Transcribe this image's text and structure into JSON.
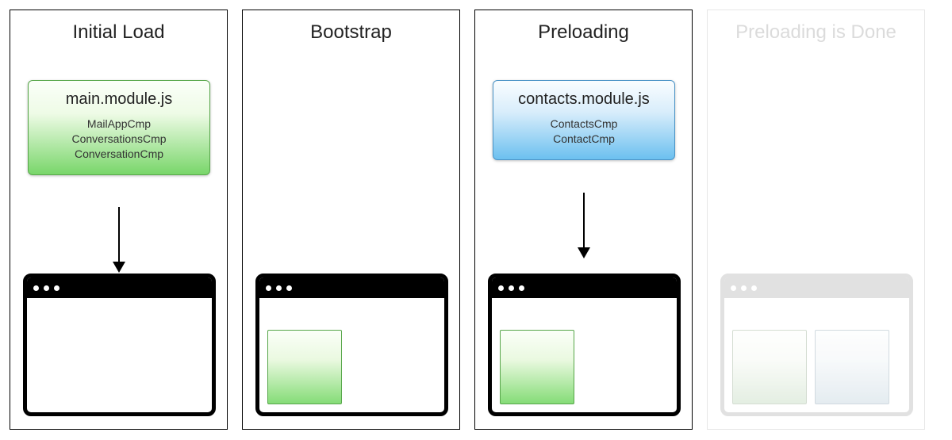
{
  "panels": [
    {
      "title": "Initial Load"
    },
    {
      "title": "Bootstrap"
    },
    {
      "title": "Preloading"
    },
    {
      "title": "Preloading is Done"
    }
  ],
  "module_main": {
    "title": "main.module.js",
    "lines": [
      "MailAppCmp",
      "ConversationsCmp",
      "ConversationCmp"
    ]
  },
  "module_contacts": {
    "title": "contacts.module.js",
    "lines": [
      "ContactsCmp",
      "ContactCmp"
    ]
  },
  "colors": {
    "green_start": "#fbfff9",
    "green_end": "#79d66a",
    "blue_start": "#fafdff",
    "blue_end": "#6cc0ef",
    "faded_border": "#c8c8c8"
  }
}
